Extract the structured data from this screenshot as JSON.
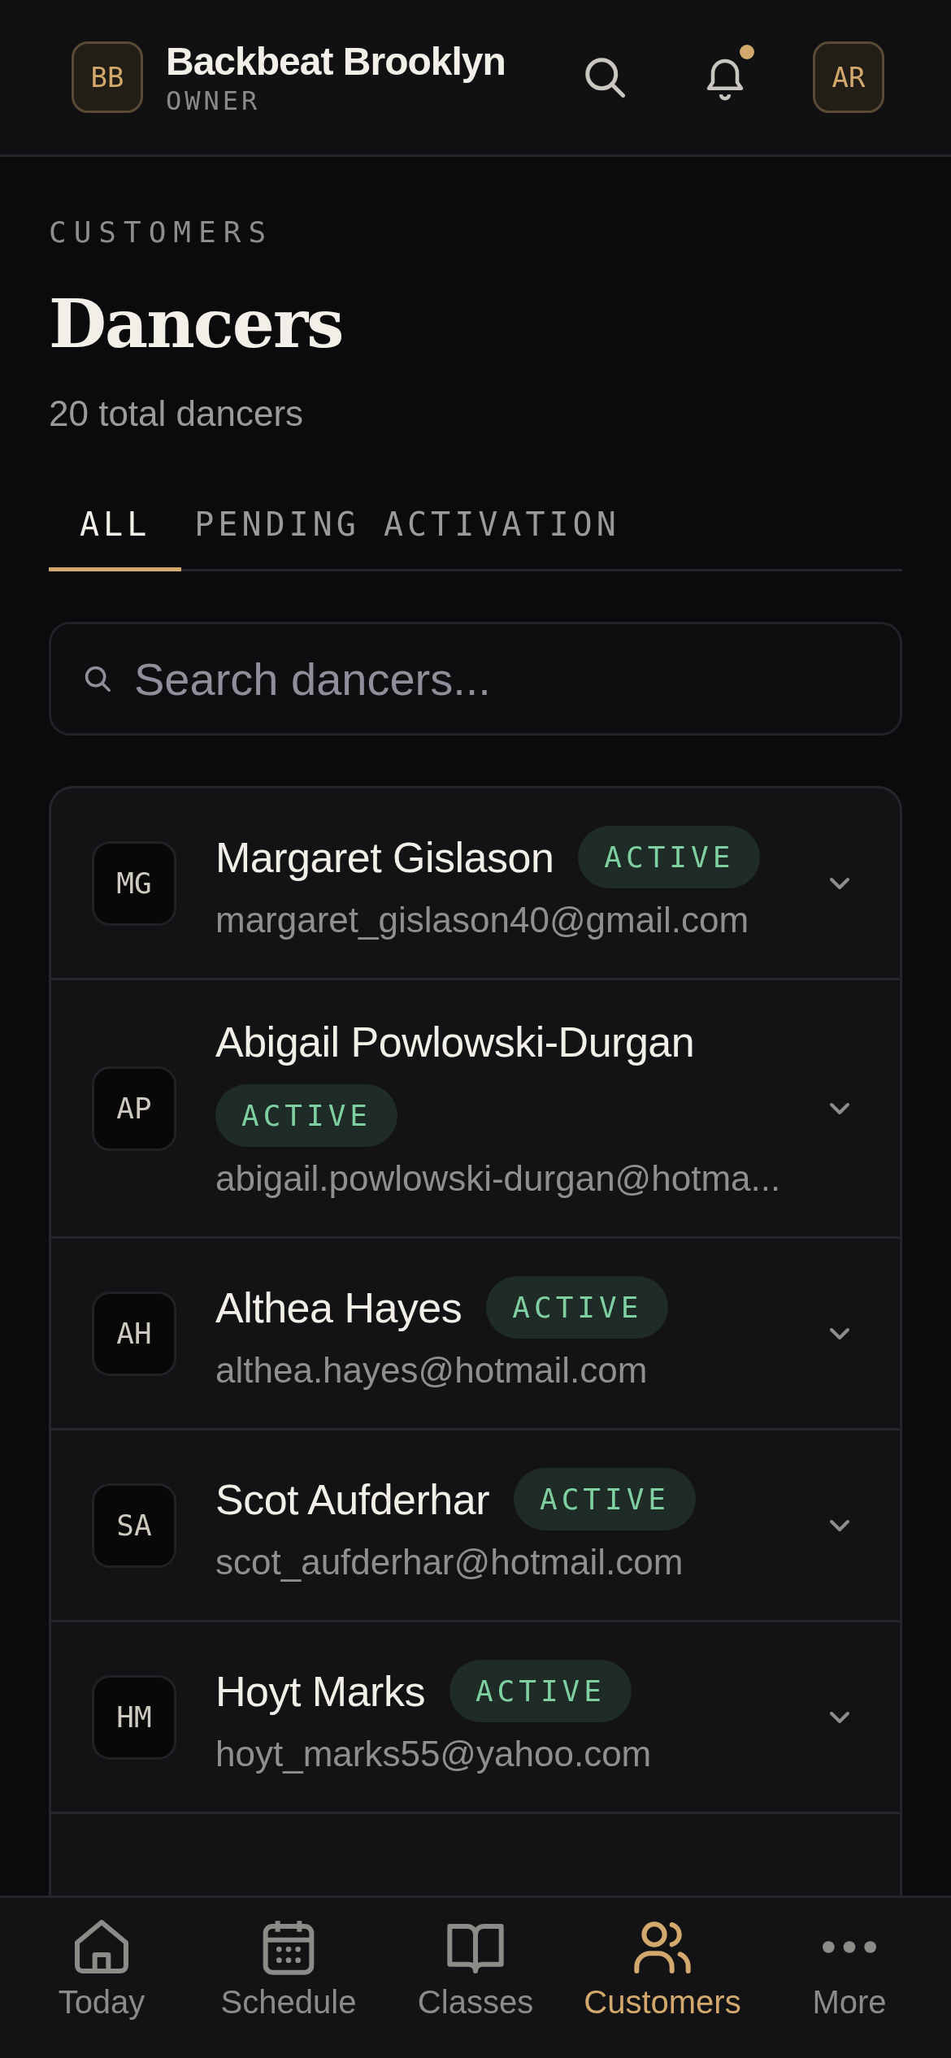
{
  "header": {
    "studio_initials": "BB",
    "studio_name": "Backbeat Brooklyn",
    "role": "OWNER",
    "has_notification": true,
    "user_initials": "AR"
  },
  "page": {
    "eyebrow": "CUSTOMERS",
    "title": "Dancers",
    "subtitle": "20 total dancers"
  },
  "tabs": [
    {
      "label": "ALL",
      "selected": true
    },
    {
      "label": "PENDING ACTIVATION",
      "selected": false
    }
  ],
  "search": {
    "placeholder": "Search dancers..."
  },
  "dancers": [
    {
      "initials": "MG",
      "name": "Margaret Gislason",
      "status": "ACTIVE",
      "email": "margaret_gislason40@gmail.com"
    },
    {
      "initials": "AP",
      "name": "Abigail Powlowski-Durgan",
      "status": "ACTIVE",
      "email": "abigail.powlowski-durgan@hotma..."
    },
    {
      "initials": "AH",
      "name": "Althea Hayes",
      "status": "ACTIVE",
      "email": "althea.hayes@hotmail.com"
    },
    {
      "initials": "SA",
      "name": "Scot Aufderhar",
      "status": "ACTIVE",
      "email": "scot_aufderhar@hotmail.com"
    },
    {
      "initials": "HM",
      "name": "Hoyt Marks",
      "status": "ACTIVE",
      "email": "hoyt_marks55@yahoo.com"
    }
  ],
  "nav": [
    {
      "kind": "home",
      "label": "Today",
      "selected": false
    },
    {
      "kind": "calendar",
      "label": "Schedule",
      "selected": false
    },
    {
      "kind": "book",
      "label": "Classes",
      "selected": false
    },
    {
      "kind": "people",
      "label": "Customers",
      "selected": true
    },
    {
      "kind": "more",
      "label": "More",
      "selected": false
    }
  ]
}
